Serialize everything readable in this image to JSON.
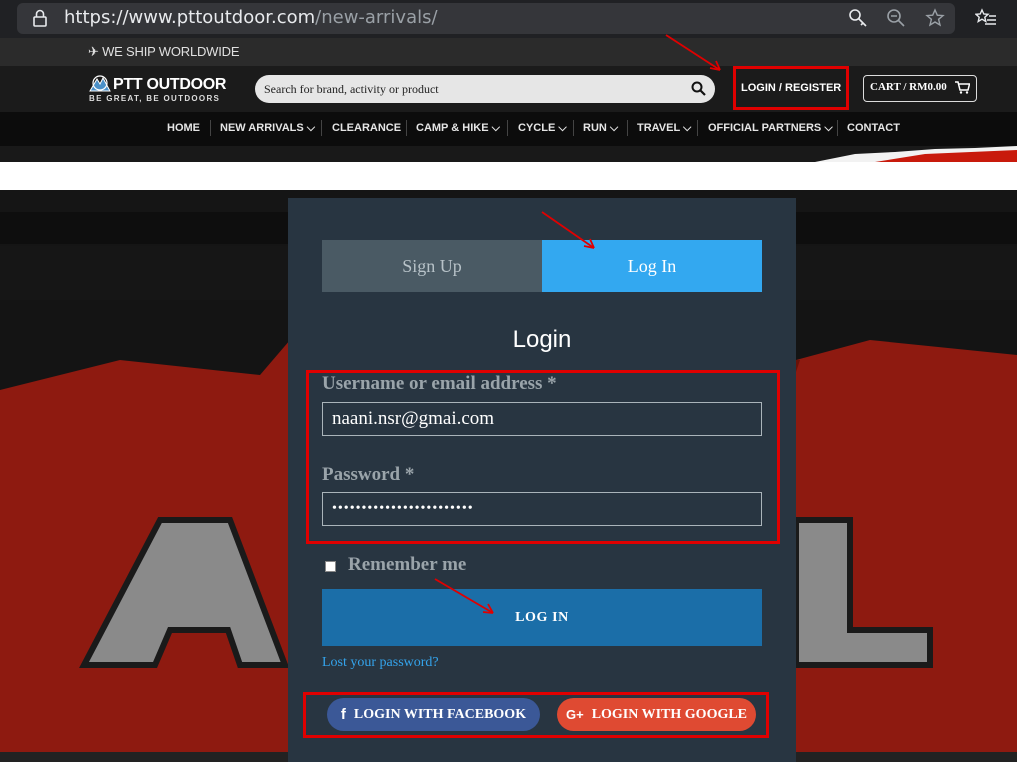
{
  "browser": {
    "url_host": "https://www.pttoutdoor.com",
    "url_path": "/new-arrivals/"
  },
  "topbar": {
    "shipping_note": "✈ WE SHIP WORLDWIDE"
  },
  "header": {
    "logo_name": "PTT OUTDOOR",
    "logo_tagline": "BE GREAT, BE OUTDOORS",
    "search_placeholder": "Search for brand, activity or product",
    "login_register_label": "LOGIN / REGISTER",
    "cart_label": "CART / RM0.00"
  },
  "nav": {
    "items": [
      {
        "label": "HOME"
      },
      {
        "label": "NEW ARRIVALS"
      },
      {
        "label": "CLEARANCE"
      },
      {
        "label": "CAMP & HIKE"
      },
      {
        "label": "CYCLE"
      },
      {
        "label": "RUN"
      },
      {
        "label": "TRAVEL"
      },
      {
        "label": "OFFICIAL PARTNERS"
      },
      {
        "label": "CONTACT"
      }
    ]
  },
  "modal": {
    "tab_signup": "Sign Up",
    "tab_login": "Log In",
    "title": "Login",
    "username_label": "Username or email address *",
    "username_value": "naani.nsr@gmai.com",
    "password_label": "Password *",
    "password_value": "••••••••••••••••••••••••",
    "remember_label": "Remember me",
    "login_button": "LOG IN",
    "lost_password": "Lost your password?",
    "facebook_button": "LOGIN WITH FACEBOOK",
    "google_button": "LOGIN WITH GOOGLE"
  },
  "colors": {
    "annotation_red": "#e00000",
    "tab_active": "#33a8f0",
    "login_button": "#1b6ea8",
    "facebook": "#3b5897",
    "google": "#df4a32",
    "link": "#34a4ec"
  }
}
